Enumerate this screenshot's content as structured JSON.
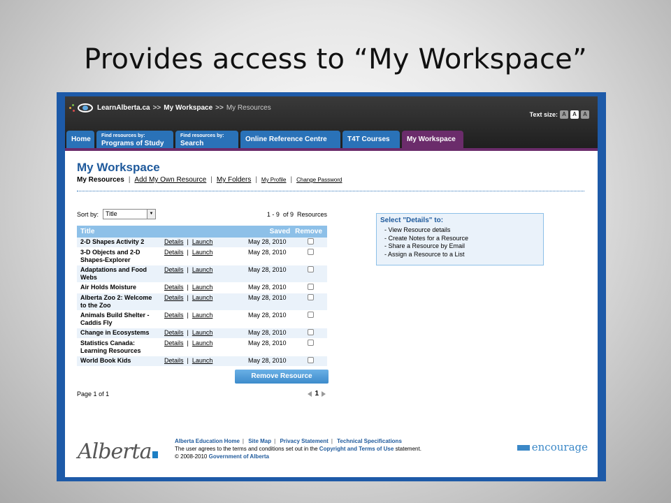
{
  "slide": {
    "title": "Provides access to “My Workspace”"
  },
  "header": {
    "site": "LearnAlberta.ca",
    "sep": ">>",
    "crumb_workspace": "My Workspace",
    "crumb_current": "My Resources",
    "textsize_label": "Text size:",
    "textsize_buttons": [
      "A",
      "A",
      "A"
    ]
  },
  "tabs": {
    "home": "Home",
    "programs_small": "Find resources by:",
    "programs": "Programs of Study",
    "search_small": "Find resources by:",
    "search": "Search",
    "reference": "Online Reference Centre",
    "t4t": "T4T Courses",
    "workspace": "My Workspace"
  },
  "page": {
    "title": "My Workspace",
    "subnav": {
      "my_resources": "My Resources",
      "add_resource": "Add My Own Resource",
      "folders": "My Folders",
      "profile": "My Profile",
      "password": "Change Password",
      "pipe": "|"
    },
    "sort_label": "Sort by:",
    "sort_value": "Title",
    "count_range": "1 - 9",
    "count_of": "of 9",
    "count_label": "Resources"
  },
  "table": {
    "headers": {
      "title": "Title",
      "saved": "Saved",
      "remove": "Remove"
    },
    "details_label": "Details",
    "launch_label": "Launch",
    "rows": [
      {
        "title": "2-D Shapes Activity 2",
        "saved": "May 28, 2010"
      },
      {
        "title": "3-D Objects and 2-D Shapes-Explorer",
        "saved": "May 28, 2010"
      },
      {
        "title": "Adaptations and Food Webs",
        "saved": "May 28, 2010"
      },
      {
        "title": "Air Holds Moisture",
        "saved": "May 28, 2010"
      },
      {
        "title": "Alberta Zoo 2: Welcome to the Zoo",
        "saved": "May 28, 2010"
      },
      {
        "title": "Animals Build Shelter - Caddis Fly",
        "saved": "May 28, 2010"
      },
      {
        "title": "Change in Ecosystems",
        "saved": "May 28, 2010"
      },
      {
        "title": "Statistics Canada: Learning Resources",
        "saved": "May 28, 2010"
      },
      {
        "title": "World Book Kids",
        "saved": "May 28, 2010"
      }
    ],
    "remove_button": "Remove Resource"
  },
  "pager": {
    "page_label": "Page",
    "page": "1",
    "of": "of",
    "total": "1",
    "current": "1"
  },
  "details": {
    "heading": "Select \"Details\" to:",
    "items": [
      "- View Resource details",
      "- Create Notes for a Resource",
      "- Share a Resource by Email",
      "- Assign a Resource to a List"
    ]
  },
  "footer": {
    "logo": "Alberta",
    "links": [
      "Alberta Education Home",
      "Site Map",
      "Privacy Statement",
      "Technical Specifications"
    ],
    "terms_pre": "The user agrees to the terms and conditions set out in the",
    "terms_link": "Copyright and Terms of Use",
    "terms_post": "statement.",
    "copyright_pre": "© 2008-2010",
    "copyright_org": "Government of Alberta",
    "encourage": "encourage"
  },
  "colors": {
    "frame": "#1d5aa8",
    "tab": "#2a72b8",
    "active_tab": "#6b2c6b",
    "title": "#1f5a9c",
    "table_header": "#8dc0e8"
  }
}
